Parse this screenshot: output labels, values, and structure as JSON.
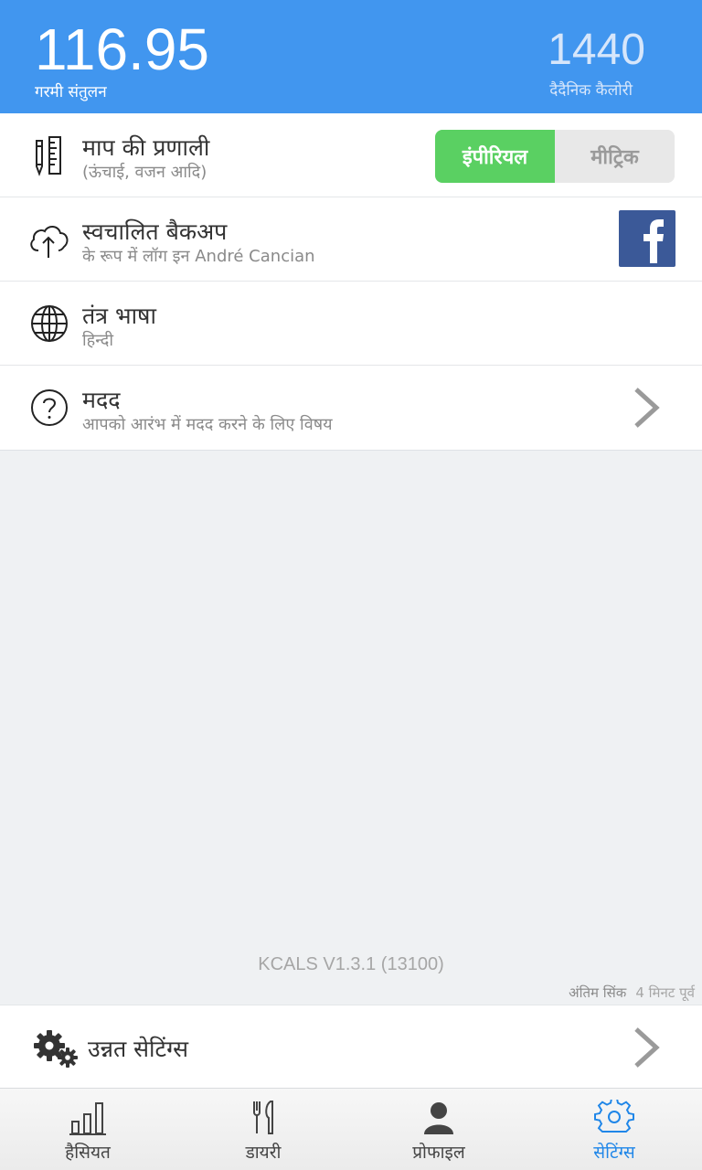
{
  "header": {
    "heat_balance_value": "116.95",
    "heat_balance_label": "गरमी संतुलन",
    "daily_calories_value": "1440",
    "daily_calories_label": "दैदैनिक कैलोरी"
  },
  "settings": {
    "units": {
      "title": "माप की प्रणाली",
      "subtitle": "(ऊंचाई, वजन आदि)",
      "imperial_label": "इंपीरियल",
      "metric_label": "मीट्रिक",
      "selected": "imperial"
    },
    "backup": {
      "title": "स्वचालित बैकअप",
      "subtitle": "के रूप में लॉग इन André Cancian"
    },
    "language": {
      "title": "तंत्र भाषा",
      "subtitle": "हिन्दी"
    },
    "help": {
      "title": "मदद",
      "subtitle": "आपको आरंभ में मदद करने के लिए विषय"
    }
  },
  "version": "KCALS V1.3.1 (13100)",
  "last_sync": {
    "label": "अंतिम सिंक",
    "value": "4 मिनट पूर्व"
  },
  "advanced_settings_label": "उन्नत सेटिंग्स",
  "nav": {
    "items": [
      {
        "label": "हैसियत",
        "icon": "bar-chart-icon"
      },
      {
        "label": "डायरी",
        "icon": "fork-knife-icon"
      },
      {
        "label": "प्रोफाइल",
        "icon": "person-icon"
      },
      {
        "label": "सेटिंग्स",
        "icon": "gear-icon"
      }
    ],
    "active_index": 3
  },
  "colors": {
    "header_blue": "#4196ef",
    "toggle_green": "#5ad062",
    "facebook_blue": "#3b5998",
    "active_nav": "#1f86e8"
  }
}
